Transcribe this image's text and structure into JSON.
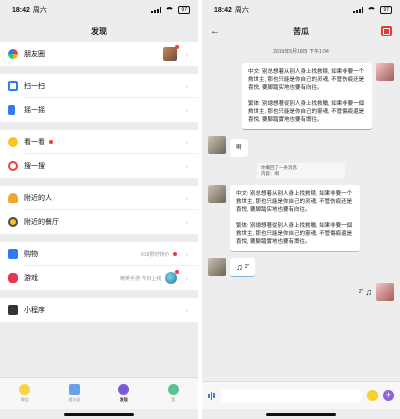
{
  "status": {
    "time": "18:42",
    "day": "周六",
    "battery": "97"
  },
  "discover": {
    "title": "发现",
    "items": [
      {
        "label": "朋友圈",
        "icon": "moments-icon",
        "color": "#f0a930"
      },
      {
        "label": "扫一扫",
        "icon": "scan-icon",
        "color": "#2d7cf6"
      },
      {
        "label": "摇一摇",
        "icon": "shake-icon",
        "color": "#2d7cf6"
      },
      {
        "label": "看一看",
        "icon": "look-icon",
        "color": "#f7c520"
      },
      {
        "label": "搜一搜",
        "icon": "search-icon",
        "color": "#f03d3d"
      },
      {
        "label": "附近的人",
        "icon": "people-nearby-icon",
        "color": "#f0a930"
      },
      {
        "label": "附近的餐厅",
        "icon": "restaurant-icon",
        "color": "#4a4a4a"
      },
      {
        "label": "购物",
        "icon": "shopping-icon",
        "color": "#2d7cf6",
        "right_text": "618限时特价"
      },
      {
        "label": "游戏",
        "icon": "game-icon",
        "color": "#e8344e",
        "right_text": "精英手游 今日上线"
      },
      {
        "label": "小程序",
        "icon": "mini-program-icon",
        "color": "#333333"
      }
    ]
  },
  "tabs": [
    {
      "label": "微信",
      "color": "#f6d34a"
    },
    {
      "label": "通讯录",
      "color": "#6aa0e8"
    },
    {
      "label": "发现",
      "color": "#7a5be0"
    },
    {
      "label": "我",
      "color": "#59c28f"
    }
  ],
  "chat": {
    "title": "苦瓜",
    "timestamp": "2019年5月18日 下午1:04",
    "msg_zh": "中文: 别总想着从别人身上找救赎, 如果非要一个救世主, 那也只能是你自己的灵魂, 不管伤痕还是喜悦, 要脚踏实地也要有向往。",
    "msg_tw": "繁体: 別總想著從別人身上找救贖, 如果非要一個救世主, 那也只能是你自己的靈魂, 不管傷痕還是喜悅, 要腳踏實地也要有嚮往。",
    "peer_text": "啊",
    "notice_line1": "你撤回了一条消息",
    "notice_line2": "内容：啊",
    "voice_left": "2\"",
    "voice_right": "2\""
  },
  "colors": {
    "accent_red": "#e53935",
    "unread": "#f23a3a"
  }
}
